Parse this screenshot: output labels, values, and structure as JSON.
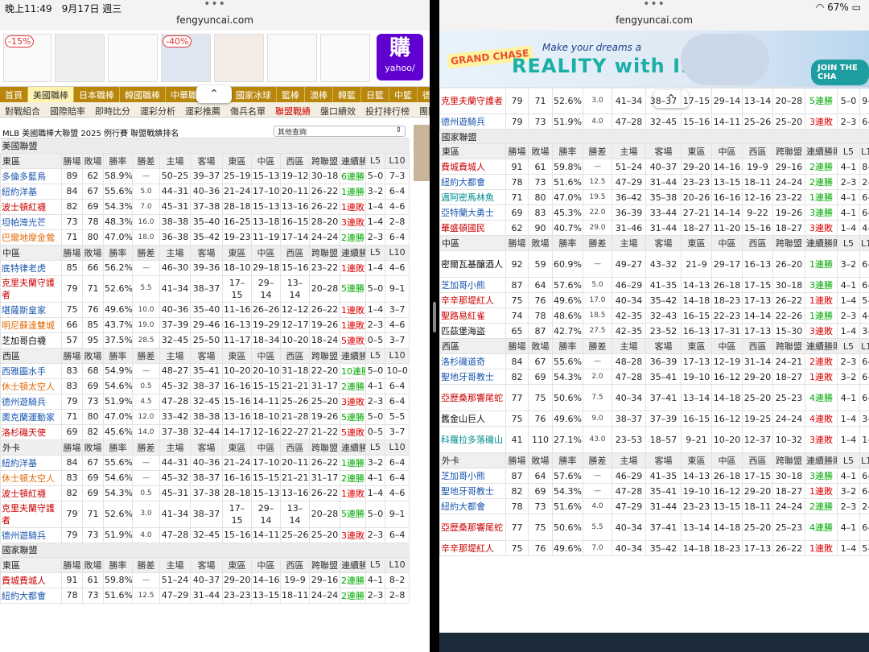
{
  "left": {
    "status": {
      "time_date": "晚上11:49　9月17日 週三"
    },
    "url": "fengyuncai.com",
    "ad": {
      "pcts": [
        "-15%",
        "-40%"
      ],
      "yahoo": {
        "glyph": "購",
        "name": "yahoo/"
      }
    },
    "nav": [
      "首頁",
      "美國職棒",
      "日本職棒",
      "韓國職棒",
      "中華職棒",
      "美",
      "國家冰球",
      "籃棒",
      "澳棒",
      "韓籃",
      "日籃",
      "中籃",
      "德籃",
      "歐"
    ],
    "subnav": [
      "對戰組合",
      "國際賠率",
      "即時比分",
      "運彩分析",
      "運彩推薦",
      "傷兵名單",
      "聯盟戰績",
      "盤口績效",
      "投打排行榜",
      "團隊打擊排行"
    ],
    "title": "MLB 美國職棒大聯盟 2025 例行賽 聯盟戰績排名",
    "select": "其他查詢",
    "header_cols": [
      "勝場",
      "敗場",
      "勝率",
      "勝差",
      "主場",
      "客場",
      "東區",
      "中區",
      "西區",
      "跨聯盟",
      "連續勝敗",
      "L5",
      "L10"
    ],
    "leagues": {
      "al": "美國聯盟",
      "nl": "國家聯盟"
    },
    "divisions": {
      "al_east": {
        "name": "東區",
        "rows": [
          [
            "多倫多藍鳥",
            "89",
            "62",
            "58.9%",
            "—",
            "50–25",
            "39–37",
            "25–19",
            "15–13",
            "19–12",
            "30–18",
            "6連勝",
            "5–0",
            "7–3"
          ],
          [
            "紐約洋基",
            "84",
            "67",
            "55.6%",
            "5.0",
            "44–31",
            "40–36",
            "21–24",
            "17–10",
            "20–11",
            "26–22",
            "1連勝",
            "3–2",
            "6–4"
          ],
          [
            "波士頓紅襪",
            "82",
            "69",
            "54.3%",
            "7.0",
            "45–31",
            "37–38",
            "28–18",
            "15–13",
            "13–16",
            "26–22",
            "1連敗",
            "1–4",
            "4–6"
          ],
          [
            "坦帕灣光芒",
            "73",
            "78",
            "48.3%",
            "16.0",
            "38–38",
            "35–40",
            "16–25",
            "13–18",
            "16–15",
            "28–20",
            "3連敗",
            "1–4",
            "2–8"
          ],
          [
            "巴爾地摩金鶯",
            "71",
            "80",
            "47.0%",
            "18.0",
            "36–38",
            "35–42",
            "19–23",
            "11–19",
            "17–14",
            "24–24",
            "2連勝",
            "2–3",
            "6–4"
          ]
        ]
      },
      "al_central": {
        "name": "中區",
        "rows": [
          [
            "底特律老虎",
            "85",
            "66",
            "56.2%",
            "—",
            "46–30",
            "39–36",
            "18–10",
            "29–18",
            "15–16",
            "23–22",
            "1連敗",
            "1–4",
            "4–6"
          ],
          [
            "克里夫蘭守護者",
            "79",
            "71",
            "52.6%",
            "5.5",
            "41–34",
            "38–37",
            "17–15",
            "29–14",
            "13–14",
            "20–28",
            "5連勝",
            "5–0",
            "9–1"
          ],
          [
            "堪薩斯皇家",
            "75",
            "76",
            "49.6%",
            "10.0",
            "40–36",
            "35–40",
            "11–16",
            "26–26",
            "12–12",
            "26–22",
            "1連敗",
            "1–4",
            "3–7"
          ],
          [
            "明尼蘇達雙城",
            "66",
            "85",
            "43.7%",
            "19.0",
            "37–39",
            "29–46",
            "16–13",
            "19–29",
            "12–17",
            "19–26",
            "1連敗",
            "2–3",
            "4–6"
          ],
          [
            "芝加哥白襪",
            "57",
            "95",
            "37.5%",
            "28.5",
            "32–45",
            "25–50",
            "11–17",
            "18–34",
            "10–20",
            "18–24",
            "5連敗",
            "0–5",
            "3–7"
          ]
        ]
      },
      "al_west": {
        "name": "西區",
        "rows": [
          [
            "西雅圖水手",
            "83",
            "68",
            "54.9%",
            "—",
            "48–27",
            "35–41",
            "10–20",
            "20–10",
            "31–18",
            "22–20",
            "10連勝",
            "5–0",
            "10–0"
          ],
          [
            "休士頓太空人",
            "83",
            "69",
            "54.6%",
            "0.5",
            "45–32",
            "38–37",
            "16–16",
            "15–15",
            "21–21",
            "31–17",
            "2連勝",
            "4–1",
            "6–4"
          ],
          [
            "德州遊騎兵",
            "79",
            "73",
            "51.9%",
            "4.5",
            "47–28",
            "32–45",
            "15–16",
            "14–11",
            "25–26",
            "25–20",
            "3連敗",
            "2–3",
            "6–4"
          ],
          [
            "奧克蘭運動家",
            "71",
            "80",
            "47.0%",
            "12.0",
            "33–42",
            "38–38",
            "13–16",
            "18–10",
            "21–28",
            "19–26",
            "5連勝",
            "5–0",
            "5–5"
          ],
          [
            "洛杉磯天使",
            "69",
            "82",
            "45.6%",
            "14.0",
            "37–38",
            "32–44",
            "14–17",
            "12–16",
            "22–27",
            "21–22",
            "5連敗",
            "0–5",
            "3–7"
          ]
        ]
      },
      "al_wild": {
        "name": "外卡",
        "rows": [
          [
            "紐約洋基",
            "84",
            "67",
            "55.6%",
            "—",
            "44–31",
            "40–36",
            "21–24",
            "17–10",
            "20–11",
            "26–22",
            "1連勝",
            "3–2",
            "6–4"
          ],
          [
            "休士頓太空人",
            "83",
            "69",
            "54.6%",
            "—",
            "45–32",
            "38–37",
            "16–16",
            "15–15",
            "21–21",
            "31–17",
            "2連勝",
            "4–1",
            "6–4"
          ],
          [
            "波士頓紅襪",
            "82",
            "69",
            "54.3%",
            "0.5",
            "45–31",
            "37–38",
            "28–18",
            "15–13",
            "13–16",
            "26–22",
            "1連敗",
            "1–4",
            "4–6"
          ],
          [
            "克里夫蘭守護者",
            "79",
            "71",
            "52.6%",
            "3.0",
            "41–34",
            "38–37",
            "17–15",
            "29–14",
            "13–14",
            "20–28",
            "5連勝",
            "5–0",
            "9–1"
          ],
          [
            "德州遊騎兵",
            "79",
            "73",
            "51.9%",
            "4.0",
            "47–28",
            "32–45",
            "15–16",
            "14–11",
            "25–26",
            "25–20",
            "3連敗",
            "2–3",
            "6–4"
          ]
        ]
      },
      "nl_east_partial": {
        "name": "東區",
        "rows": [
          [
            "費城費城人",
            "91",
            "61",
            "59.8%",
            "—",
            "51–24",
            "40–37",
            "29–20",
            "14–16",
            "19–9",
            "29–16",
            "2連勝",
            "4–1",
            "8–2"
          ],
          [
            "紐約大都會",
            "78",
            "73",
            "51.6%",
            "12.5",
            "47–29",
            "31–44",
            "23–23",
            "13–15",
            "18–11",
            "24–24",
            "2連勝",
            "2–3",
            "2–8"
          ]
        ]
      }
    }
  },
  "right": {
    "status": {
      "battery": "67%"
    },
    "url": "fengyuncai.com",
    "banner": {
      "logo": "GRAND CHASE",
      "tagline": "Make your dreams a",
      "headline": "REALITY with IRIS",
      "cta": "JOIN THE CHA",
      "corner": "N"
    },
    "top_rows": [
      [
        "克里夫蘭守護者",
        "79",
        "71",
        "52.6%",
        "3.0",
        "41–34",
        "38–37",
        "17–15",
        "29–14",
        "13–14",
        "20–28",
        "5連勝",
        "5–0",
        "9–"
      ],
      [
        "德州遊騎兵",
        "79",
        "73",
        "51.9%",
        "4.0",
        "47–28",
        "32–45",
        "15–16",
        "14–11",
        "25–26",
        "25–20",
        "3連敗",
        "2–3",
        "6–"
      ]
    ],
    "divisions": {
      "nl_east": {
        "name": "東區",
        "rows": [
          [
            "費城費城人",
            "91",
            "61",
            "59.8%",
            "—",
            "51–24",
            "40–37",
            "29–20",
            "14–16",
            "19–9",
            "29–16",
            "2連勝",
            "4–1",
            "8–"
          ],
          [
            "紐約大都會",
            "78",
            "73",
            "51.6%",
            "12.5",
            "47–29",
            "31–44",
            "23–23",
            "13–15",
            "18–11",
            "24–24",
            "2連勝",
            "2–3",
            "2–"
          ],
          [
            "邁阿密馬林魚",
            "71",
            "80",
            "47.0%",
            "19.5",
            "36–42",
            "35–38",
            "20–26",
            "16–16",
            "12–16",
            "23–22",
            "1連勝",
            "4–1",
            "6–"
          ],
          [
            "亞特蘭大勇士",
            "69",
            "83",
            "45.3%",
            "22.0",
            "36–39",
            "33–44",
            "27–21",
            "14–14",
            "9–22",
            "19–26",
            "3連勝",
            "4–1",
            "6–"
          ],
          [
            "華盛頓國民",
            "62",
            "90",
            "40.7%",
            "29.0",
            "31–46",
            "31–44",
            "18–27",
            "11–20",
            "15–16",
            "18–27",
            "3連敗",
            "1–4",
            "4–"
          ]
        ]
      },
      "nl_central": {
        "name": "中區",
        "rows": [
          [
            "密爾瓦基釀酒人",
            "92",
            "59",
            "60.9%",
            "—",
            "49–27",
            "43–32",
            "21–9",
            "29–17",
            "16–13",
            "26–20",
            "1連勝",
            "3–2",
            "6–"
          ],
          [
            "芝加哥小熊",
            "87",
            "64",
            "57.6%",
            "5.0",
            "46–29",
            "41–35",
            "14–13",
            "26–18",
            "17–15",
            "30–18",
            "3連勝",
            "4–1",
            "6–"
          ],
          [
            "辛辛那堤紅人",
            "75",
            "76",
            "49.6%",
            "17.0",
            "40–34",
            "35–42",
            "14–18",
            "18–23",
            "17–13",
            "26–22",
            "1連敗",
            "1–4",
            "5–"
          ],
          [
            "聖路易紅雀",
            "74",
            "78",
            "48.6%",
            "18.5",
            "42–35",
            "32–43",
            "16–15",
            "22–23",
            "14–14",
            "22–26",
            "1連勝",
            "2–3",
            "4–"
          ],
          [
            "匹茲堡海盜",
            "65",
            "87",
            "42.7%",
            "27.5",
            "42–35",
            "23–52",
            "16–13",
            "17–31",
            "17–13",
            "15–30",
            "3連敗",
            "1–4",
            "3–"
          ]
        ]
      },
      "nl_west": {
        "name": "西區",
        "rows": [
          [
            "洛杉磯道奇",
            "84",
            "67",
            "55.6%",
            "—",
            "48–28",
            "36–39",
            "17–13",
            "12–19",
            "31–14",
            "24–21",
            "2連敗",
            "2–3",
            "6–"
          ],
          [
            "聖地牙哥教士",
            "82",
            "69",
            "54.3%",
            "2.0",
            "47–28",
            "35–41",
            "19–10",
            "16–12",
            "29–20",
            "18–27",
            "1連敗",
            "3–2",
            "6–"
          ],
          [
            "亞歷桑那響尾蛇",
            "77",
            "75",
            "50.6%",
            "7.5",
            "40–34",
            "37–41",
            "13–14",
            "14–18",
            "25–20",
            "25–23",
            "4連勝",
            "4–1",
            "6–"
          ],
          [
            "舊金山巨人",
            "75",
            "76",
            "49.6%",
            "9.0",
            "38–37",
            "37–39",
            "16–15",
            "16–12",
            "19–25",
            "24–24",
            "4連敗",
            "1–4",
            "3–"
          ],
          [
            "科羅拉多落磯山",
            "41",
            "110",
            "27.1%",
            "43.0",
            "23–53",
            "18–57",
            "9–21",
            "10–20",
            "12–37",
            "10–32",
            "3連敗",
            "1–4",
            "1–"
          ]
        ]
      },
      "nl_wild": {
        "name": "外卡",
        "rows": [
          [
            "芝加哥小熊",
            "87",
            "64",
            "57.6%",
            "—",
            "46–29",
            "41–35",
            "14–13",
            "26–18",
            "17–15",
            "30–18",
            "3連勝",
            "4–1",
            "6–"
          ],
          [
            "聖地牙哥教士",
            "82",
            "69",
            "54.3%",
            "—",
            "47–28",
            "35–41",
            "19–10",
            "16–12",
            "29–20",
            "18–27",
            "1連敗",
            "3–2",
            "6–"
          ],
          [
            "紐約大都會",
            "78",
            "73",
            "51.6%",
            "4.0",
            "47–29",
            "31–44",
            "23–23",
            "13–15",
            "18–11",
            "24–24",
            "2連勝",
            "2–3",
            "2–"
          ],
          [
            "亞歷桑那響尾蛇",
            "77",
            "75",
            "50.6%",
            "5.5",
            "40–34",
            "37–41",
            "13–14",
            "14–18",
            "25–20",
            "25–23",
            "4連勝",
            "4–1",
            "6–"
          ],
          [
            "辛辛那堤紅人",
            "75",
            "76",
            "49.6%",
            "7.0",
            "40–34",
            "35–42",
            "14–18",
            "18–23",
            "17–13",
            "26–22",
            "1連敗",
            "1–4",
            "5–"
          ]
        ]
      }
    }
  },
  "colors": {
    "nav": "#b8860b",
    "win_streak": "#00aa00",
    "loss_streak": "#dd0000",
    "link": "#1a56b0"
  }
}
